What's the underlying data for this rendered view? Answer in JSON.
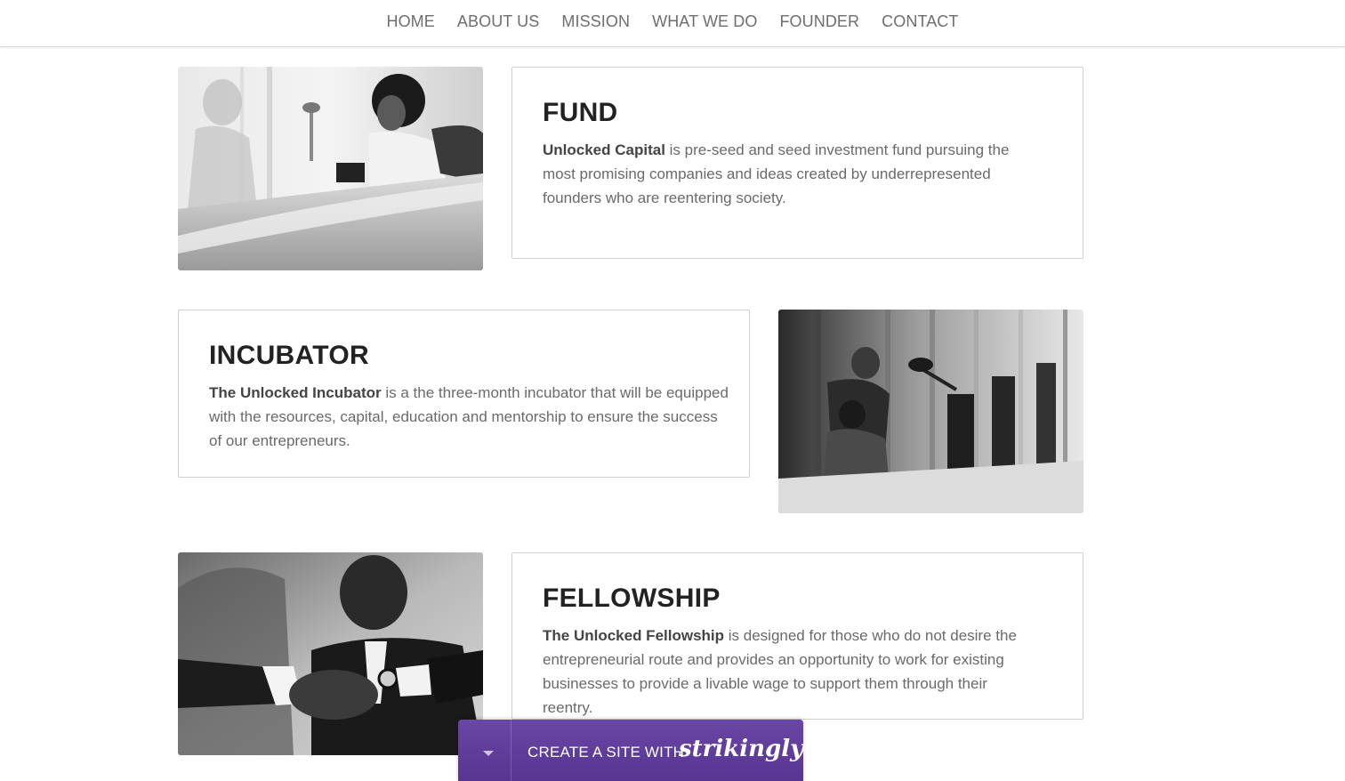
{
  "nav": {
    "items": [
      {
        "label": "HOME"
      },
      {
        "label": "ABOUT US"
      },
      {
        "label": "MISSION"
      },
      {
        "label": "WHAT WE DO"
      },
      {
        "label": "FOUNDER"
      },
      {
        "label": "CONTACT"
      }
    ]
  },
  "sections": {
    "fund": {
      "title": "FUND",
      "bold": "Unlocked Capital",
      "text": " is pre-seed and seed investment fund pursuing the most promising companies and ideas created by underrepresented founders who are reentering society."
    },
    "incubator": {
      "title": "INCUBATOR",
      "bold": "The Unlocked Incubator",
      "text": " is a the three-month incubator that will be equipped with the resources, capital, education and mentorship to ensure the success of our entrepreneurs."
    },
    "fellowship": {
      "title": "FELLOWSHIP",
      "bold": "The Unlocked Fellowship",
      "text": " is designed for those who do not desire the entrepreneurial route and provides an opportunity to work for existing businesses to provide a livable wage to support them through their reentry."
    }
  },
  "promo": {
    "label": "CREATE A SITE WITH",
    "brand": "strikingly"
  },
  "colors": {
    "promo_purple": "#5f3d9c",
    "nav_text": "#6e6e6e",
    "card_border": "#cfcfcf"
  }
}
